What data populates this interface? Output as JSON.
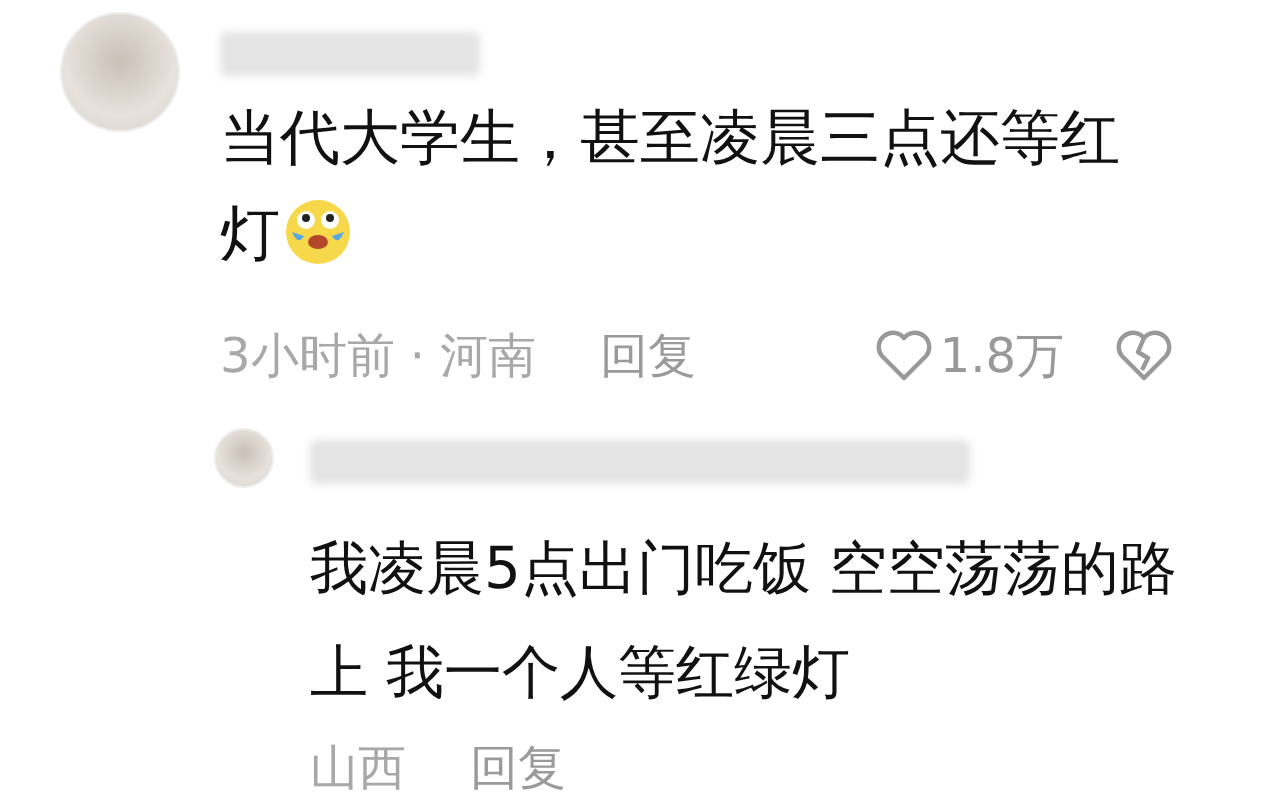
{
  "comments": [
    {
      "text": "当代大学生，甚至凌晨三点还等红灯",
      "meta": "3小时前 · 河南",
      "reply_label": "回复",
      "likes": "1.8万",
      "replies": [
        {
          "text": "我凌晨5点出门吃饭 空空荡荡的路上 我一个人等红绿灯",
          "location": "山西",
          "reply_label": "回复"
        }
      ]
    }
  ]
}
